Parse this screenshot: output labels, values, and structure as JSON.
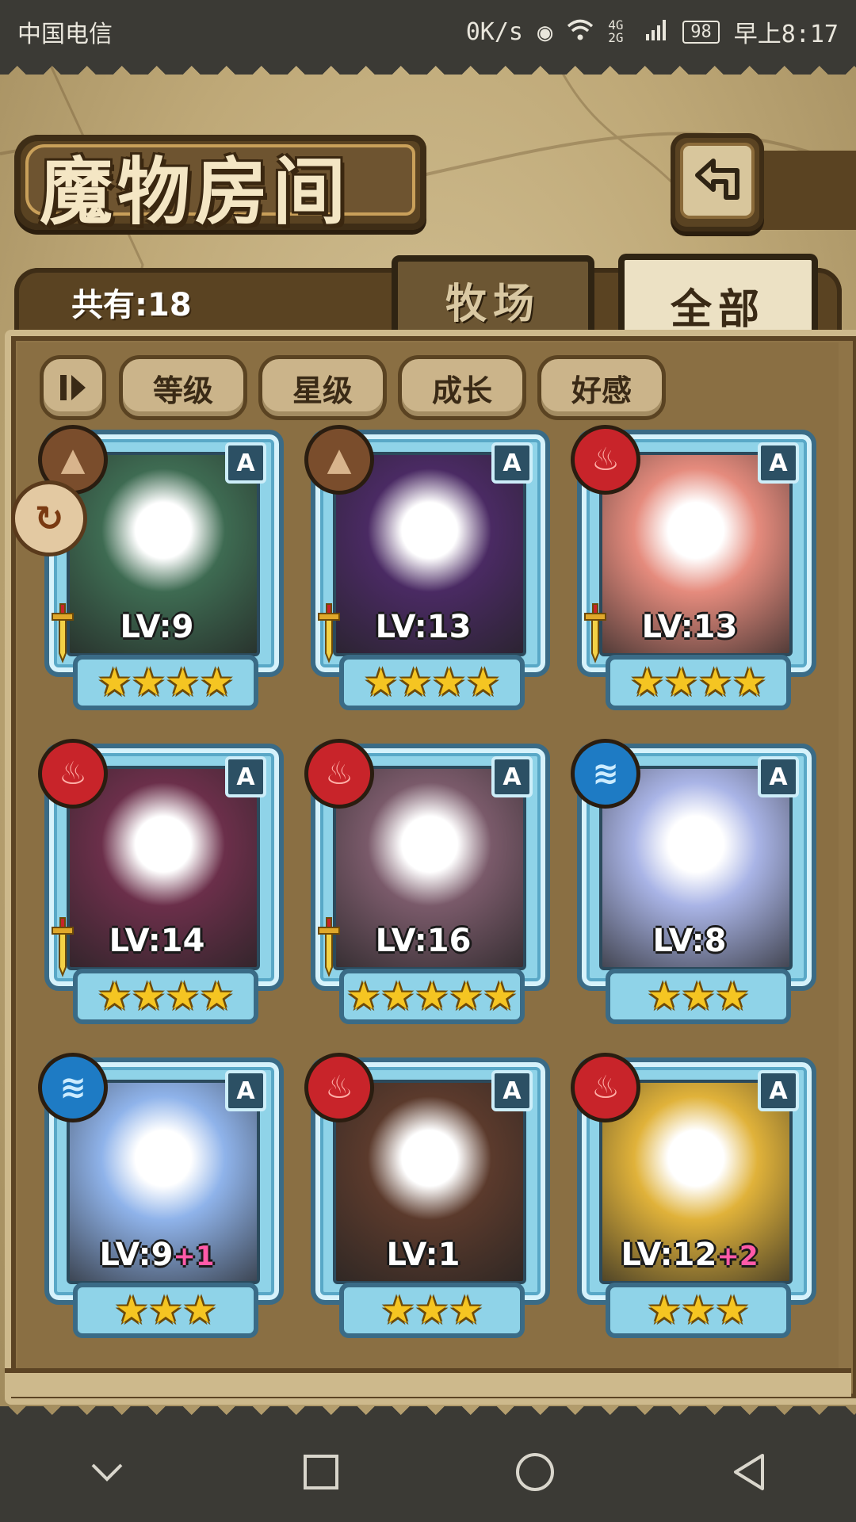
{
  "status_bar": {
    "carrier": "中国电信",
    "speed": "0K/s",
    "network": "4G 2G",
    "battery": "98",
    "time": "早上8:17"
  },
  "header": {
    "title": "魔物房间",
    "back_icon": "back-arrow-icon"
  },
  "count_label": "共有:18",
  "tabs": [
    {
      "label": "牧场",
      "selected": false
    },
    {
      "label": "全部",
      "selected": true
    }
  ],
  "sort_buttons": [
    {
      "label": "等级"
    },
    {
      "label": "星级"
    },
    {
      "label": "成长"
    },
    {
      "label": "好感"
    }
  ],
  "monsters": [
    {
      "element": "earth",
      "rank": "A",
      "level": "LV:9",
      "plus": "",
      "stars": "★★★★",
      "equipped": true,
      "art_color": "#3e6b52"
    },
    {
      "element": "earth",
      "rank": "A",
      "level": "LV:13",
      "plus": "",
      "stars": "★★★★",
      "equipped": true,
      "art_color": "#4a2a63"
    },
    {
      "element": "fire",
      "rank": "A",
      "level": "LV:13",
      "plus": "",
      "stars": "★★★★",
      "equipped": true,
      "art_color": "#e58b7d"
    },
    {
      "element": "fire",
      "rank": "A",
      "level": "LV:14",
      "plus": "",
      "stars": "★★★★",
      "equipped": true,
      "art_color": "#6b2f4a"
    },
    {
      "element": "fire",
      "rank": "A",
      "level": "LV:16",
      "plus": "",
      "stars": "★★★★★",
      "equipped": true,
      "art_color": "#7a5a6a"
    },
    {
      "element": "water",
      "rank": "A",
      "level": "LV:8",
      "plus": "",
      "stars": "★★★",
      "equipped": false,
      "art_color": "#a9b4e6"
    },
    {
      "element": "water",
      "rank": "A",
      "level": "LV:9",
      "plus": "+1",
      "stars": "★★★",
      "equipped": false,
      "art_color": "#8fb3ea"
    },
    {
      "element": "fire",
      "rank": "A",
      "level": "LV:1",
      "plus": "",
      "stars": "★★★",
      "equipped": false,
      "art_color": "#5b3a2c"
    },
    {
      "element": "fire",
      "rank": "A",
      "level": "LV:12",
      "plus": "+2",
      "stars": "★★★",
      "equipped": false,
      "art_color": "#e0b23a"
    }
  ]
}
